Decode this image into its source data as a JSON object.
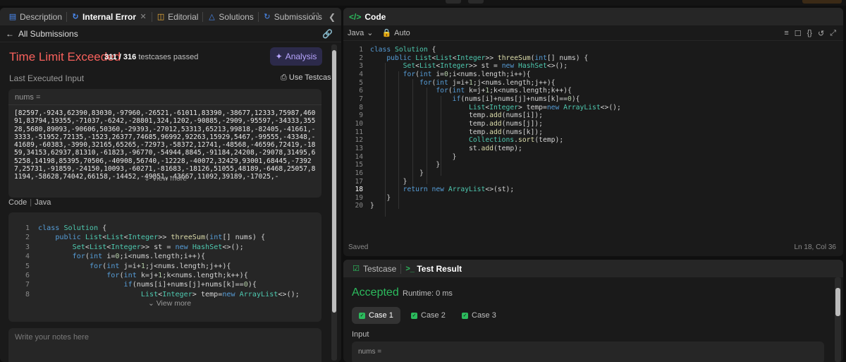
{
  "left_tabs": {
    "description": "Description",
    "internal_error": "Internal Error",
    "editorial": "Editorial",
    "solutions": "Solutions",
    "submissions": "Submissions"
  },
  "left_header": {
    "all_submissions": "All Submissions"
  },
  "result": {
    "status": "Time Limit Exceeded",
    "passed": "311",
    "total": "/ 316",
    "passed_label": "testcases passed",
    "analysis_label": "Analysis"
  },
  "last_input": {
    "label": "Last Executed Input",
    "use_testcase": "Use Testcase",
    "var_name": "nums =",
    "value": "[82597,-9243,62390,83030,-97960,-26521,-61011,83390,-38677,12333,75987,46091,83794,19355,-71037,-6242,-28801,324,1202,-90885,-2909,-95597,-34333,35528,5680,89093,-90606,50360,-29393,-27012,53313,65213,99818,-82405,-41661,-3333,-51952,72135,-1523,26377,74685,96992,92263,15929,5467,-99555,-43348,-41689,-60383,-3990,32165,65265,-72973,-58372,12741,-48568,-46596,72419,-1859,34153,62937,81310,-61823,-96770,-54944,8845,-91184,24208,-29078,31495,65258,14198,85395,70506,-40908,56740,-12228,-40072,32429,93001,68445,-73927,25731,-91859,-24150,10093,-60271,-81683,-18126,51055,48189,-6468,25057,81194,-58628,74042,66158,-14452,-49851,-43667,11092,39189,-17025,-",
    "view_more": "View more"
  },
  "code_section": {
    "label": "Code",
    "language": "Java",
    "view_more": "View more"
  },
  "notes": {
    "placeholder": "Write your notes here"
  },
  "editor": {
    "title": "Code",
    "language": "Java",
    "mode": "Auto",
    "status": "Saved",
    "cursor": "Ln 18, Col 36"
  },
  "bottom": {
    "testcase_tab": "Testcase",
    "result_tab": "Test Result",
    "accepted": "Accepted",
    "runtime": "Runtime: 0 ms",
    "cases": [
      "Case 1",
      "Case 2",
      "Case 3"
    ],
    "input_label": "Input",
    "input_var": "nums ="
  },
  "colors": {
    "tle_red": "#f8615c",
    "accepted_green": "#2cbb5d",
    "analysis_purple": "#b8a6ff",
    "keyword_blue": "#569cd6",
    "type_teal": "#4ec9b0"
  }
}
